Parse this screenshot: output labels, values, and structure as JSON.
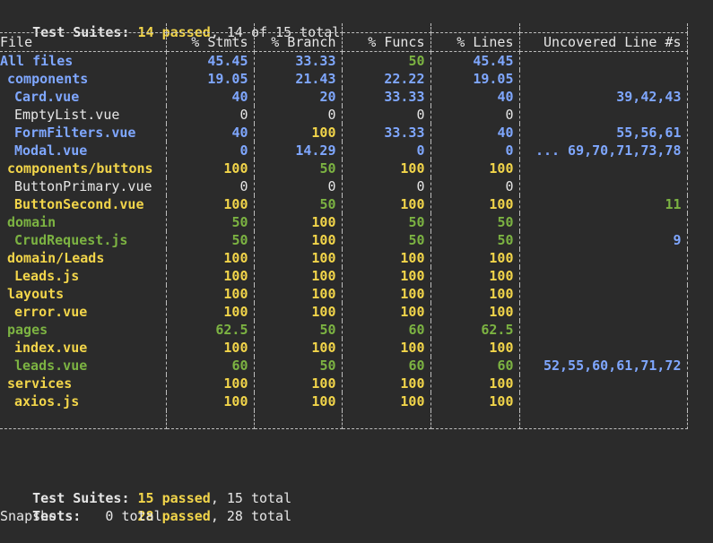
{
  "top_summary": {
    "label": "Test Suites:",
    "passed": "14 passed",
    "rest": ", 14 of 15 total"
  },
  "colors": {
    "yellow": "#f2d54a",
    "green": "#7cb342",
    "blue": "#7fa7ff",
    "white": "#e6e6e6"
  },
  "table": {
    "headers": [
      "File",
      "% Stmts",
      "% Branch",
      "% Funcs",
      "% Lines",
      "Uncovered Line #s"
    ],
    "rows": [
      {
        "file": "All files",
        "indent": 0,
        "color": "blue",
        "bold": true,
        "stmts": "45.45",
        "branch": "33.33",
        "funcs": "50",
        "lines": "45.45",
        "uncovered": "",
        "colors": [
          "blue",
          "blue",
          "green",
          "blue",
          "blue"
        ]
      },
      {
        "file": "components",
        "indent": 1,
        "color": "blue",
        "bold": true,
        "stmts": "19.05",
        "branch": "21.43",
        "funcs": "22.22",
        "lines": "19.05",
        "uncovered": "",
        "colors": [
          "blue",
          "blue",
          "blue",
          "blue",
          "blue"
        ]
      },
      {
        "file": "Card.vue",
        "indent": 2,
        "color": "blue",
        "bold": true,
        "stmts": "40",
        "branch": "20",
        "funcs": "33.33",
        "lines": "40",
        "uncovered": "39,42,43",
        "colors": [
          "blue",
          "blue",
          "blue",
          "blue",
          "blue"
        ]
      },
      {
        "file": "EmptyList.vue",
        "indent": 2,
        "color": "white",
        "bold": false,
        "stmts": "0",
        "branch": "0",
        "funcs": "0",
        "lines": "0",
        "uncovered": "",
        "colors": [
          "white",
          "white",
          "white",
          "white",
          "white"
        ]
      },
      {
        "file": "FormFilters.vue",
        "indent": 2,
        "color": "blue",
        "bold": true,
        "stmts": "40",
        "branch": "100",
        "funcs": "33.33",
        "lines": "40",
        "uncovered": "55,56,61",
        "colors": [
          "blue",
          "yellow",
          "blue",
          "blue",
          "blue"
        ]
      },
      {
        "file": "Modal.vue",
        "indent": 2,
        "color": "blue",
        "bold": true,
        "stmts": "0",
        "branch": "14.29",
        "funcs": "0",
        "lines": "0",
        "uncovered": "... 69,70,71,73,78",
        "colors": [
          "blue",
          "blue",
          "blue",
          "blue",
          "blue"
        ]
      },
      {
        "file": "components/buttons",
        "indent": 1,
        "color": "yellow",
        "bold": true,
        "stmts": "100",
        "branch": "50",
        "funcs": "100",
        "lines": "100",
        "uncovered": "",
        "colors": [
          "yellow",
          "green",
          "yellow",
          "yellow",
          "white"
        ]
      },
      {
        "file": "ButtonPrimary.vue",
        "indent": 2,
        "color": "white",
        "bold": false,
        "stmts": "0",
        "branch": "0",
        "funcs": "0",
        "lines": "0",
        "uncovered": "",
        "colors": [
          "white",
          "white",
          "white",
          "white",
          "white"
        ]
      },
      {
        "file": "ButtonSecond.vue",
        "indent": 2,
        "color": "yellow",
        "bold": true,
        "stmts": "100",
        "branch": "50",
        "funcs": "100",
        "lines": "100",
        "uncovered": "11",
        "colors": [
          "yellow",
          "green",
          "yellow",
          "yellow",
          "green"
        ]
      },
      {
        "file": "domain",
        "indent": 1,
        "color": "green",
        "bold": true,
        "stmts": "50",
        "branch": "100",
        "funcs": "50",
        "lines": "50",
        "uncovered": "",
        "colors": [
          "green",
          "yellow",
          "green",
          "green",
          "white"
        ]
      },
      {
        "file": "CrudRequest.js",
        "indent": 2,
        "color": "green",
        "bold": true,
        "stmts": "50",
        "branch": "100",
        "funcs": "50",
        "lines": "50",
        "uncovered": "9",
        "colors": [
          "green",
          "yellow",
          "green",
          "green",
          "blue"
        ]
      },
      {
        "file": "domain/Leads",
        "indent": 1,
        "color": "yellow",
        "bold": true,
        "stmts": "100",
        "branch": "100",
        "funcs": "100",
        "lines": "100",
        "uncovered": "",
        "colors": [
          "yellow",
          "yellow",
          "yellow",
          "yellow",
          "white"
        ]
      },
      {
        "file": "Leads.js",
        "indent": 2,
        "color": "yellow",
        "bold": true,
        "stmts": "100",
        "branch": "100",
        "funcs": "100",
        "lines": "100",
        "uncovered": "",
        "colors": [
          "yellow",
          "yellow",
          "yellow",
          "yellow",
          "white"
        ]
      },
      {
        "file": "layouts",
        "indent": 1,
        "color": "yellow",
        "bold": true,
        "stmts": "100",
        "branch": "100",
        "funcs": "100",
        "lines": "100",
        "uncovered": "",
        "colors": [
          "yellow",
          "yellow",
          "yellow",
          "yellow",
          "white"
        ]
      },
      {
        "file": "error.vue",
        "indent": 2,
        "color": "yellow",
        "bold": true,
        "stmts": "100",
        "branch": "100",
        "funcs": "100",
        "lines": "100",
        "uncovered": "",
        "colors": [
          "yellow",
          "yellow",
          "yellow",
          "yellow",
          "white"
        ]
      },
      {
        "file": "pages",
        "indent": 1,
        "color": "green",
        "bold": true,
        "stmts": "62.5",
        "branch": "50",
        "funcs": "60",
        "lines": "62.5",
        "uncovered": "",
        "colors": [
          "green",
          "green",
          "green",
          "green",
          "white"
        ]
      },
      {
        "file": "index.vue",
        "indent": 2,
        "color": "yellow",
        "bold": true,
        "stmts": "100",
        "branch": "100",
        "funcs": "100",
        "lines": "100",
        "uncovered": "",
        "colors": [
          "yellow",
          "yellow",
          "yellow",
          "yellow",
          "white"
        ]
      },
      {
        "file": "leads.vue",
        "indent": 2,
        "color": "green",
        "bold": true,
        "stmts": "60",
        "branch": "50",
        "funcs": "60",
        "lines": "60",
        "uncovered": "52,55,60,61,71,72",
        "colors": [
          "green",
          "green",
          "green",
          "green",
          "blue"
        ]
      },
      {
        "file": "services",
        "indent": 1,
        "color": "yellow",
        "bold": true,
        "stmts": "100",
        "branch": "100",
        "funcs": "100",
        "lines": "100",
        "uncovered": "",
        "colors": [
          "yellow",
          "yellow",
          "yellow",
          "yellow",
          "white"
        ]
      },
      {
        "file": "axios.js",
        "indent": 2,
        "color": "yellow",
        "bold": true,
        "stmts": "100",
        "branch": "100",
        "funcs": "100",
        "lines": "100",
        "uncovered": "",
        "colors": [
          "yellow",
          "yellow",
          "yellow",
          "yellow",
          "white"
        ]
      }
    ]
  },
  "bottom_summary": {
    "suites_label": "Test Suites:",
    "suites_passed": "15 passed",
    "suites_rest": ", 15 total",
    "tests_label": "Tests:",
    "tests_passed": "28 passed",
    "tests_rest": ", 28 total",
    "cut_line": "Snapshots:   0 total"
  }
}
